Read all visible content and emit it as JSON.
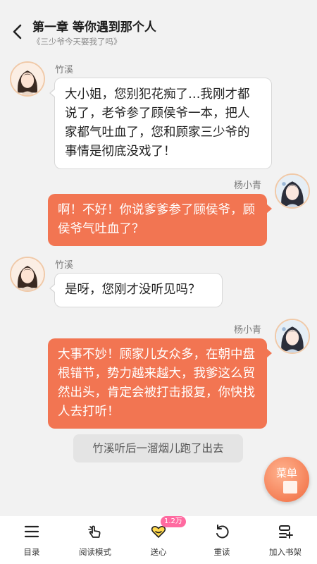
{
  "header": {
    "chapter_title": "第一章 等你遇到那个人",
    "book_title": "《三少爷今天娶我了吗》"
  },
  "messages": [
    {
      "side": "left",
      "speaker": "竹溪",
      "text": "大小姐，您别犯花痴了…我刚才都说了，老爷参了顾侯爷一本，把人家都气吐血了，您和顾家三少爷的事情是彻底没戏了！"
    },
    {
      "side": "right",
      "speaker": "杨小青",
      "text": "啊！不好！你说爹爹参了顾侯爷，顾侯爷气吐血了？"
    },
    {
      "side": "left",
      "speaker": "竹溪",
      "text": "是呀，您刚才没听见吗？"
    },
    {
      "side": "right",
      "speaker": "杨小青",
      "text": "大事不妙！顾家儿女众多，在朝中盘根错节，势力越来越大，我爹这么贸然出头，肯定会被打击报复，你快找人去打听！"
    }
  ],
  "narration": "竹溪听后一溜烟儿跑了出去",
  "menu_fab": {
    "label": "菜单"
  },
  "bottom_nav": {
    "items": [
      {
        "label": "目录",
        "icon": "list-icon"
      },
      {
        "label": "阅读模式",
        "icon": "tap-hand-icon"
      },
      {
        "label": "送心",
        "icon": "heart-gift-icon",
        "badge": "1.2万"
      },
      {
        "label": "重读",
        "icon": "replay-icon"
      },
      {
        "label": "加入书架",
        "icon": "add-bookshelf-icon"
      }
    ]
  },
  "colors": {
    "accent": "#f27552",
    "background": "#f2f2f2",
    "badge": "#ff6aa0"
  }
}
